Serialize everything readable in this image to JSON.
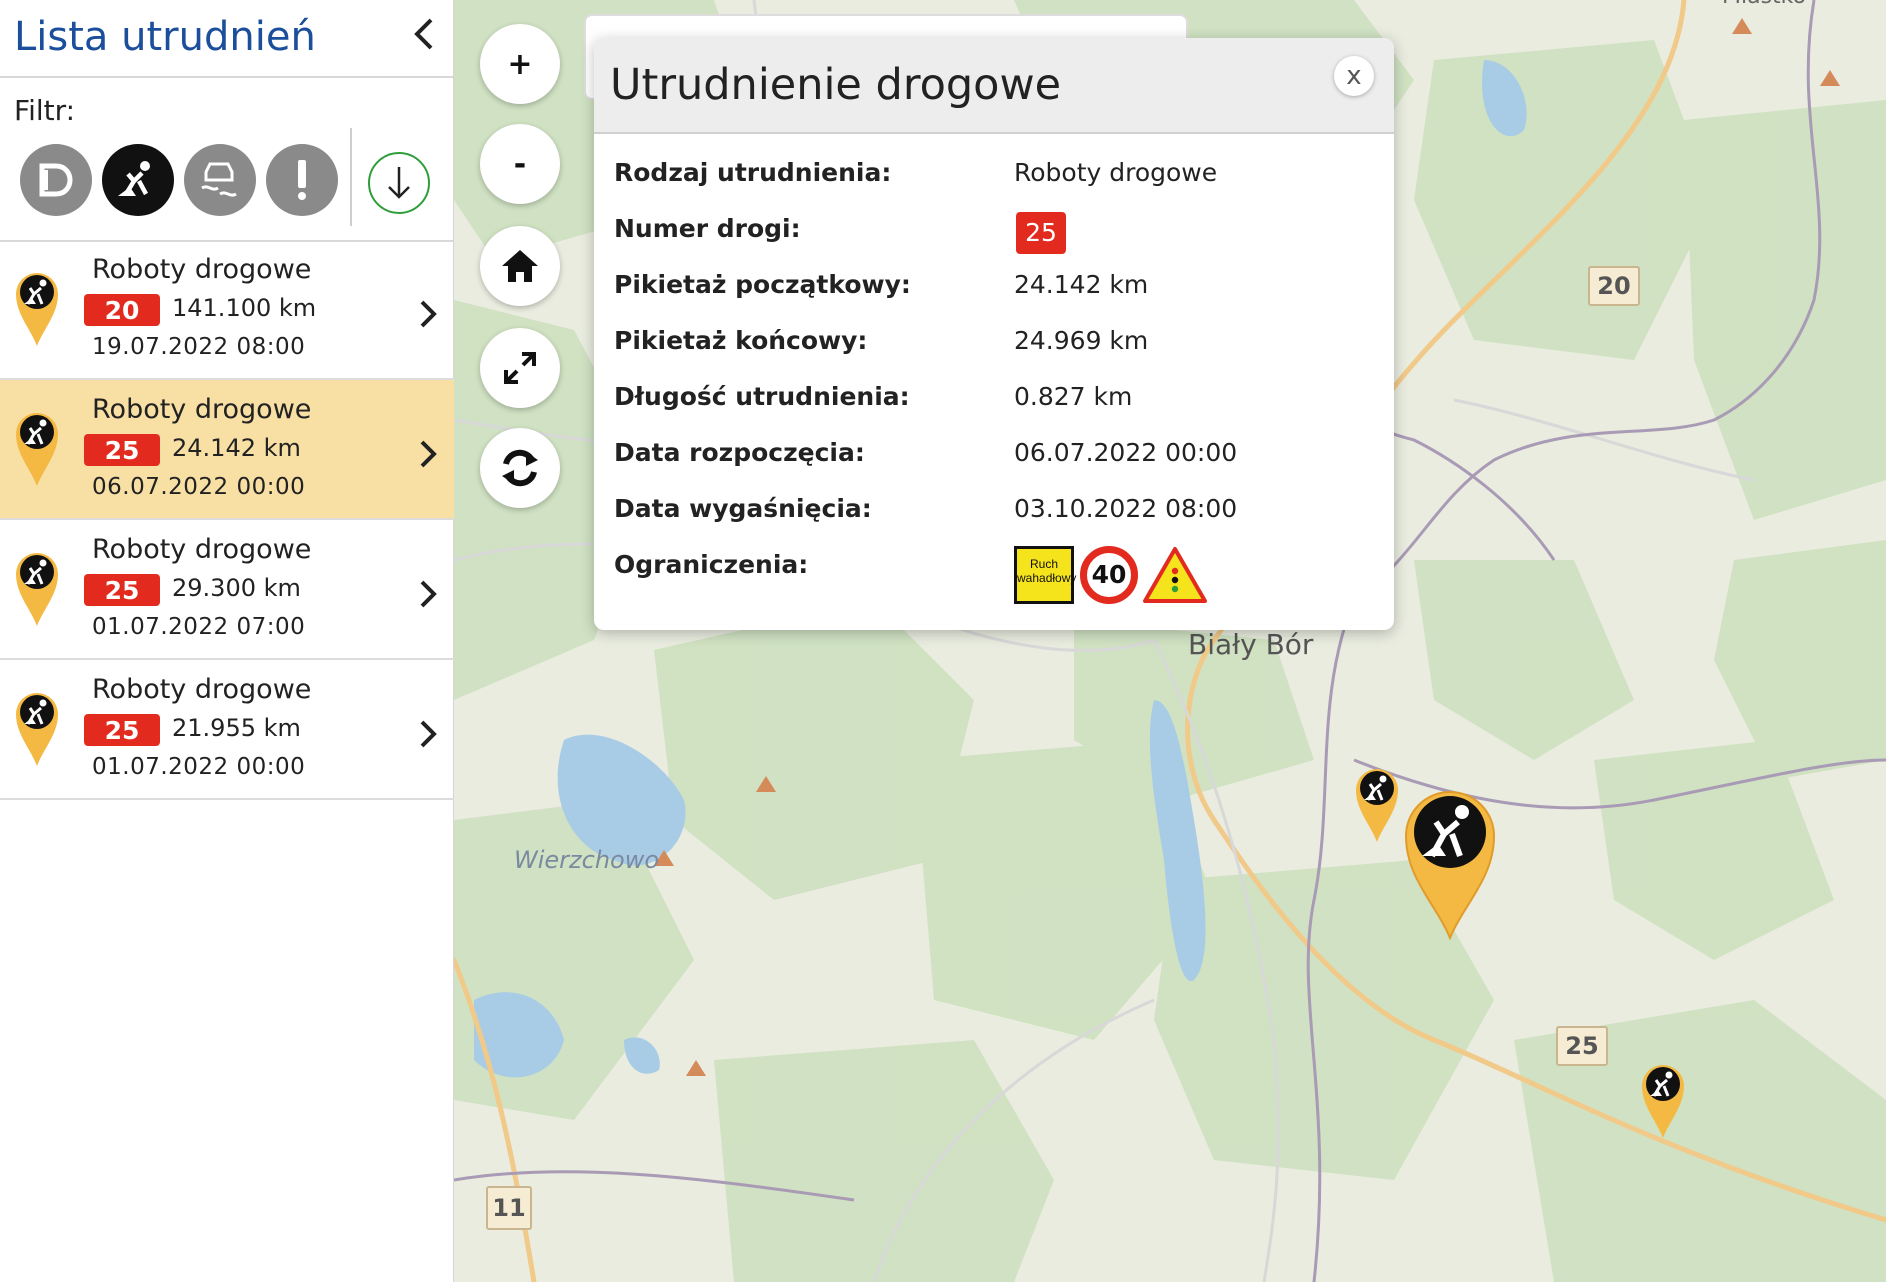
{
  "sidebar": {
    "title": "Lista utrudnień",
    "filter_label": "Filtr:",
    "filters": [
      {
        "icon": "bridge-icon",
        "active": false
      },
      {
        "icon": "roadwork-icon",
        "active": true
      },
      {
        "icon": "slippery-road-icon",
        "active": false
      },
      {
        "icon": "exclamation-icon",
        "active": false
      }
    ],
    "download_icon": "download-icon",
    "items": [
      {
        "title": "Roboty drogowe",
        "road": "20",
        "km": "141.100 km",
        "date": "19.07.2022 08:00",
        "selected": false
      },
      {
        "title": "Roboty drogowe",
        "road": "25",
        "km": "24.142 km",
        "date": "06.07.2022 00:00",
        "selected": true
      },
      {
        "title": "Roboty drogowe",
        "road": "25",
        "km": "29.300 km",
        "date": "01.07.2022 07:00",
        "selected": false
      },
      {
        "title": "Roboty drogowe",
        "road": "25",
        "km": "21.955 km",
        "date": "01.07.2022 00:00",
        "selected": false
      }
    ]
  },
  "map_controls": {
    "zoom_in": "+",
    "zoom_out": "-"
  },
  "map": {
    "places": [
      "Biały Bór",
      "Wierzchowo"
    ],
    "shields": [
      "20",
      "25",
      "11"
    ],
    "top_label": "Miastko"
  },
  "popup": {
    "title": "Utrudnienie drogowe",
    "close": "x",
    "rows": [
      {
        "label": "Rodzaj utrudnienia:",
        "value": "Roboty drogowe"
      },
      {
        "label": "Numer drogi:",
        "value": "25"
      },
      {
        "label": "Pikietaż początkowy:",
        "value": "24.142 km"
      },
      {
        "label": "Pikietaż końcowy:",
        "value": "24.969 km"
      },
      {
        "label": "Długość utrudnienia:",
        "value": "0.827 km"
      },
      {
        "label": "Data rozpoczęcia:",
        "value": "06.07.2022 00:00"
      },
      {
        "label": "Data wygaśnięcia:",
        "value": "03.10.2022 08:00"
      },
      {
        "label": "Ograniczenia:",
        "value": ""
      }
    ],
    "restriction_sign_text": [
      "Ruch",
      "wahadłowy"
    ],
    "speed_limit": "40"
  },
  "colors": {
    "brand_blue": "#1b4f9c",
    "road_badge_red": "#e32a1f",
    "marker_orange": "#f4b942",
    "selected_row": "#f8e0a5"
  }
}
